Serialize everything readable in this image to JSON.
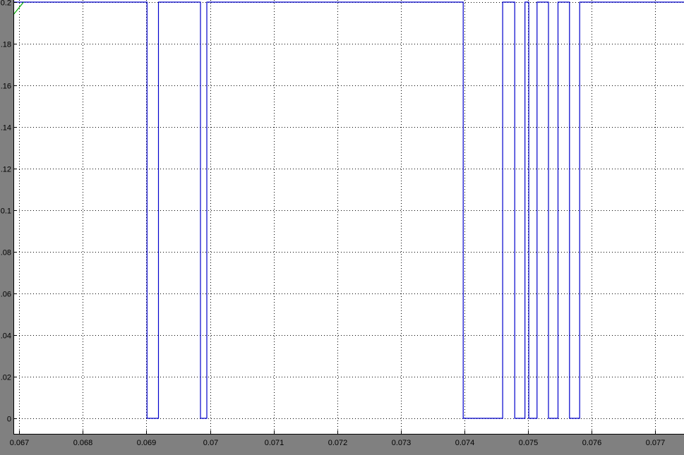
{
  "figure": {
    "background_color": "#808080",
    "axes_color": "#ffffff",
    "grid_color": "#000000",
    "signal_color": "#0000cc",
    "trace_color": "#00aa00"
  },
  "chart_data": {
    "type": "line",
    "title": "",
    "xlabel": "",
    "ylabel": "",
    "xlim": [
      0.06691,
      0.07745
    ],
    "ylim": [
      0.0,
      0.2
    ],
    "grid": true,
    "x_ticks": [
      0.067,
      0.068,
      0.069,
      0.07,
      0.071,
      0.072,
      0.073,
      0.074,
      0.075,
      0.076,
      0.077
    ],
    "x_tick_labels": [
      "0.067",
      "0.068",
      "0.069",
      "0.07",
      "0.071",
      "0.072",
      "0.073",
      "0.074",
      "0.075",
      "0.076",
      "0.077"
    ],
    "y_ticks": [
      0.0,
      0.02,
      0.04,
      0.06,
      0.08,
      0.1,
      0.12,
      0.14,
      0.16,
      0.18,
      0.2
    ],
    "y_tick_labels": [
      "0",
      ".02",
      ".04",
      ".06",
      ".08",
      "0.1",
      ".12",
      ".14",
      ".16",
      ".18",
      "0.2"
    ],
    "series": [
      {
        "style": "step",
        "color": "#0000cc",
        "x": [
          0.06691,
          0.06901,
          0.06901,
          0.06919,
          0.06919,
          0.06985,
          0.06985,
          0.06995,
          0.06995,
          0.07398,
          0.07398,
          0.0746,
          0.0746,
          0.07479,
          0.07479,
          0.07495,
          0.07495,
          0.07501,
          0.07501,
          0.07514,
          0.07514,
          0.07532,
          0.07532,
          0.07547,
          0.07547,
          0.07565,
          0.07565,
          0.07581,
          0.07581,
          0.07745
        ],
        "y": [
          0.2,
          0.2,
          0.0,
          0.0,
          0.2,
          0.2,
          0.0,
          0.0,
          0.2,
          0.2,
          0.0,
          0.0,
          0.2,
          0.2,
          0.0,
          0.0,
          0.2,
          0.2,
          0.0,
          0.0,
          0.2,
          0.2,
          0.0,
          0.0,
          0.2,
          0.2,
          0.0,
          0.0,
          0.2,
          0.2
        ]
      },
      {
        "style": "line",
        "color": "#00aa00",
        "x": [
          0.06691,
          0.06707
        ],
        "y": [
          0.194,
          0.2
        ]
      }
    ]
  }
}
